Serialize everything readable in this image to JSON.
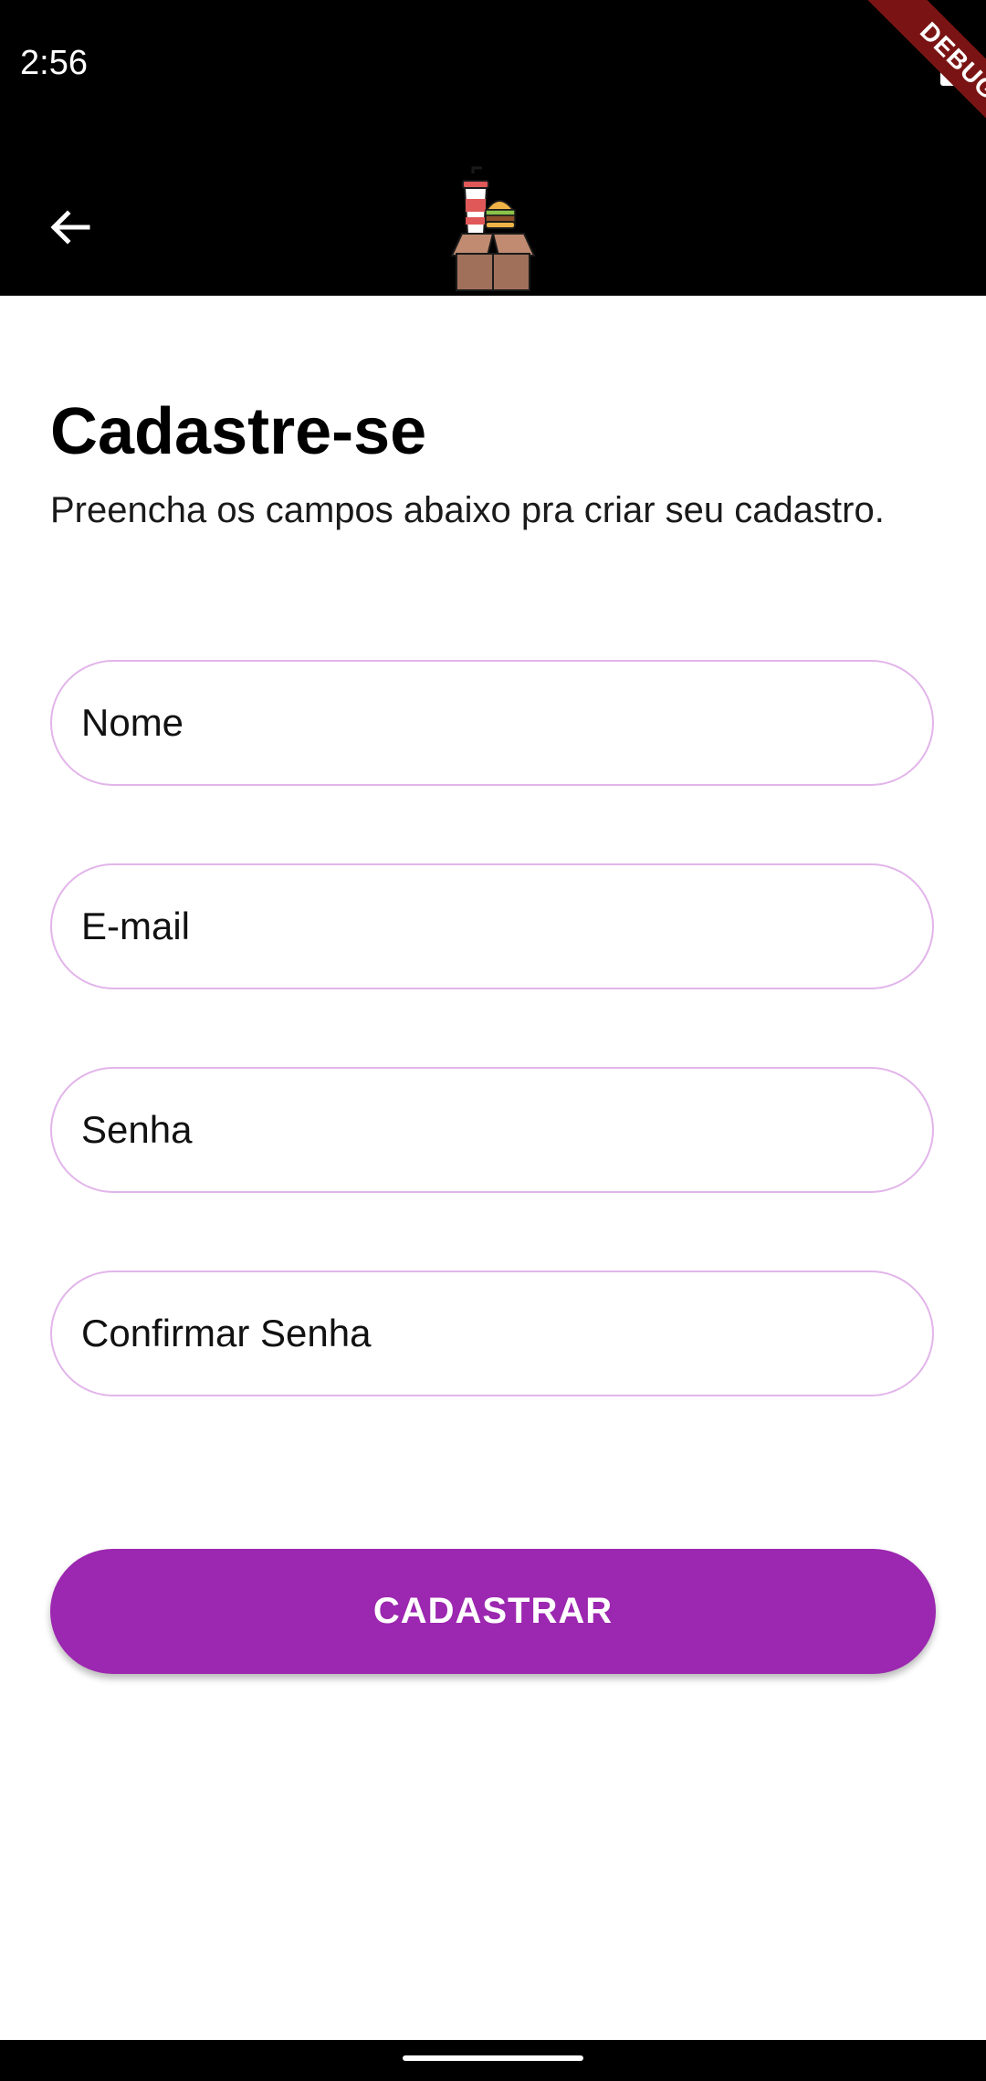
{
  "status_bar": {
    "time": "2:56",
    "debug_label": "DEBUG"
  },
  "app_bar": {
    "back_icon": "arrow-left-icon",
    "logo_icon": "food-box-logo-icon"
  },
  "page": {
    "title": "Cadastre-se",
    "subtitle": "Preencha os campos abaixo pra criar seu cadastro."
  },
  "form": {
    "name_placeholder": "Nome",
    "email_placeholder": "E-mail",
    "password_placeholder": "Senha",
    "confirm_password_placeholder": "Confirmar Senha",
    "submit_label": "CADASTRAR"
  },
  "colors": {
    "accent": "#9c27b0",
    "field_border": "#e2b5ea",
    "debug_banner": "#7a1414"
  }
}
